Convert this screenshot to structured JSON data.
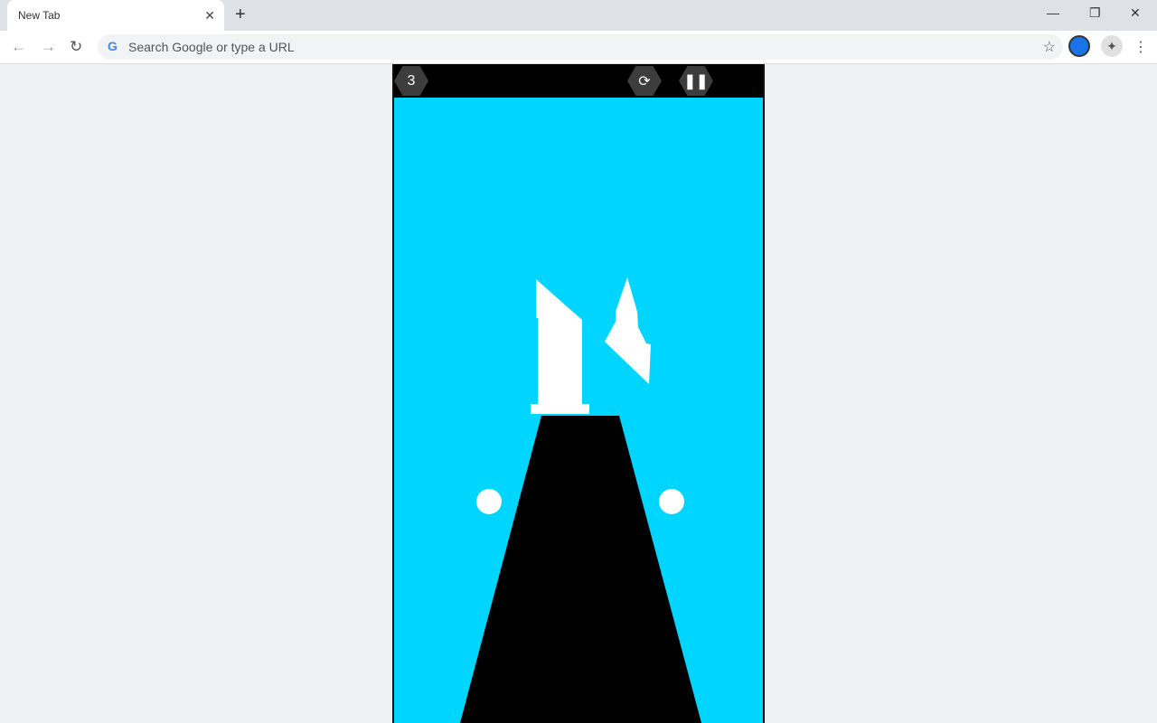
{
  "browser": {
    "tab_title": "New Tab",
    "omnibox_placeholder": "Search Google or type a URL"
  },
  "game": {
    "score": "3",
    "restart_icon": "refresh-icon",
    "pause_icon": "pause-icon",
    "colors": {
      "sky": "#00d5ff",
      "road": "#000000",
      "objects": "#ffffff",
      "hud": "#3d3d3d"
    }
  }
}
